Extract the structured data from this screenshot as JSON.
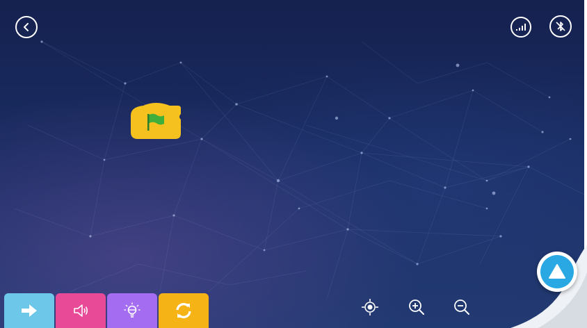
{
  "icons": {
    "back": "back-arrow-icon",
    "signal": "signal-strength-icon",
    "bluetooth": "bluetooth-disabled-icon",
    "flag": "green-flag-icon",
    "motion": "arrow-right-icon",
    "sound": "speaker-icon",
    "light": "light-bulb-icon",
    "control": "repeat-icon",
    "recenter": "crosshair-icon",
    "zoom_in": "zoom-in-icon",
    "zoom_out": "zoom-out-icon",
    "run": "triangle-up-icon"
  },
  "colors": {
    "background": "#1a2c62",
    "hat_block": "#f5c11e",
    "flag": "#3fae3a",
    "tab_motion": "#6cc7e8",
    "tab_sound": "#e84a98",
    "tab_light": "#a46cf0",
    "tab_control": "#f5b316",
    "run_button": "#2aa8e4"
  }
}
